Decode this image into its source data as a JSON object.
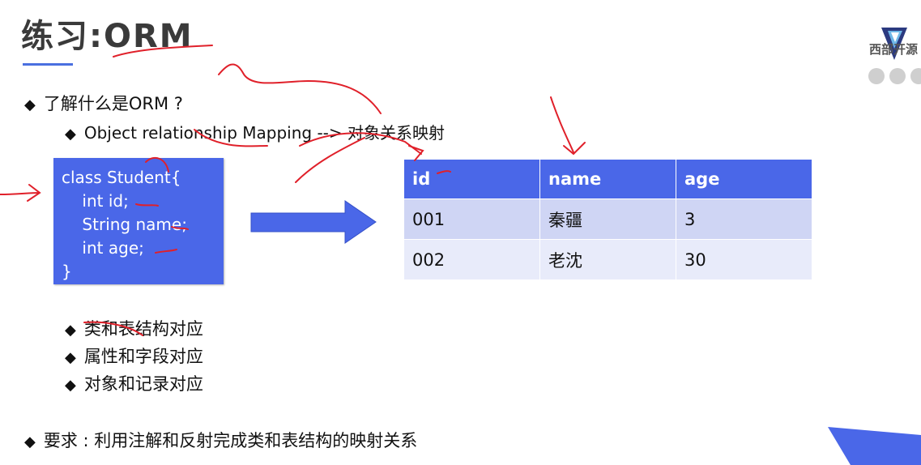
{
  "title": "练习:ORM",
  "logo": {
    "text": "西部开源"
  },
  "bullets": {
    "q1": "了解什么是ORM ?",
    "q1_sub": "Object relationship Mapping --> 对象关系映射",
    "map1": "类和表结构对应",
    "map2": "属性和字段对应",
    "map3": "对象和记录对应",
    "req": "要求 : 利用注解和反射完成类和表结构的映射关系"
  },
  "code": {
    "lines": [
      "class Student{",
      "    int id;",
      "    String name;",
      "    int age;",
      "}"
    ]
  },
  "table": {
    "headers": [
      "id",
      "name",
      "age"
    ],
    "rows": [
      [
        "001",
        "秦疆",
        "3"
      ],
      [
        "002",
        "老沈",
        "30"
      ]
    ]
  },
  "colors": {
    "accent": "#4a67e8",
    "row_dark": "#cfd5f4",
    "row_light": "#e8ebfa",
    "annotation": "#e0202a"
  }
}
